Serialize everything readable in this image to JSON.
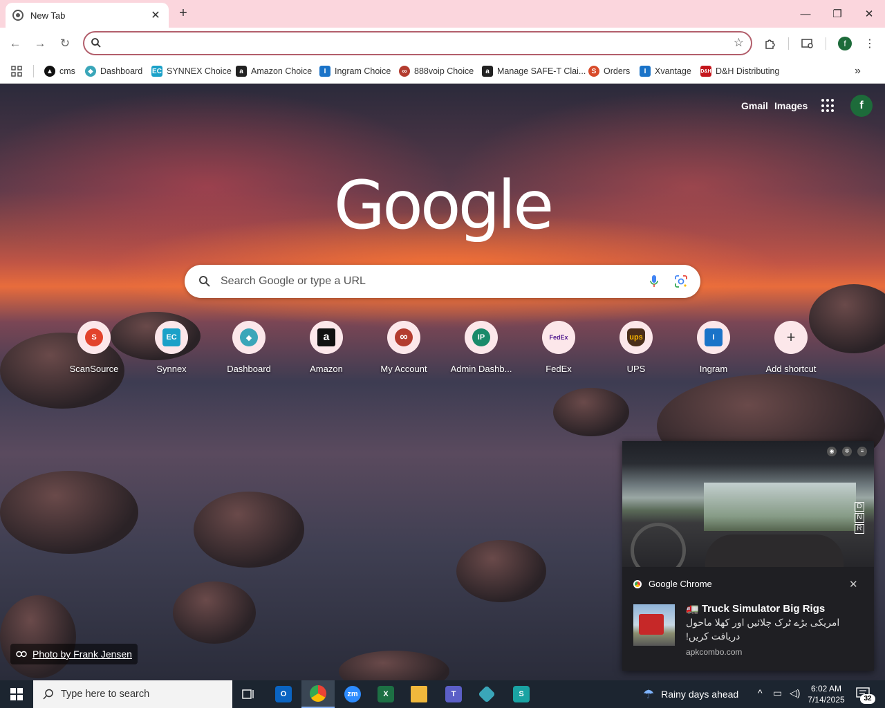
{
  "tab": {
    "title": "New Tab",
    "close": "✕",
    "new_tab": "+"
  },
  "window": {
    "minimize": "—",
    "maximize": "❐",
    "close": "✕"
  },
  "omnibox": {
    "value": ""
  },
  "bookmarks": [
    {
      "label": "cms",
      "icon": "cms-icon",
      "color": "#111111"
    },
    {
      "label": "Dashboard",
      "icon": "dashboard-icon",
      "color": "#3aa6b9"
    },
    {
      "label": "SYNNEX Choice",
      "icon": "synnex-icon",
      "color": "#1ba1c8"
    },
    {
      "label": "Amazon Choice",
      "icon": "amazon-icon",
      "color": "#222222"
    },
    {
      "label": "Ingram Choice",
      "icon": "ingram-icon",
      "color": "#1a73c8"
    },
    {
      "label": "888voip Choice",
      "icon": "888voip-icon",
      "color": "#b33c2f"
    },
    {
      "label": "Manage SAFE-T Clai...",
      "icon": "amazon-icon",
      "color": "#222222"
    },
    {
      "label": "Orders",
      "icon": "orders-icon",
      "color": "#d84b2a"
    },
    {
      "label": "Xvantage",
      "icon": "xvantage-icon",
      "color": "#1a73c8"
    },
    {
      "label": "D&H Distributing",
      "icon": "dh-icon",
      "color": "#c4161c"
    }
  ],
  "ntp": {
    "gmail": "Gmail",
    "images": "Images",
    "profile_initial": "f",
    "logo": "Google",
    "search_placeholder": "Search Google or type a URL",
    "shortcuts": [
      {
        "label": "ScanSource",
        "glyph": "S",
        "color": "#e2432c"
      },
      {
        "label": "Synnex",
        "glyph": "EC",
        "color": "#1ba1c8"
      },
      {
        "label": "Dashboard",
        "glyph": "◆",
        "color": "#3aa6b9"
      },
      {
        "label": "Amazon",
        "glyph": "a",
        "color": "#111111"
      },
      {
        "label": "My Account",
        "glyph": "∞",
        "color": "#b33c2f"
      },
      {
        "label": "Admin Dashb...",
        "glyph": "IP",
        "color": "#1a8a6a"
      },
      {
        "label": "FedEx",
        "glyph": "FedEx",
        "color": "#4d148c"
      },
      {
        "label": "UPS",
        "glyph": "ups",
        "color": "#4b2e1a"
      },
      {
        "label": "Ingram",
        "glyph": "I",
        "color": "#1a73c8"
      },
      {
        "label": "Add shortcut",
        "glyph": "+",
        "color": "#333333"
      }
    ],
    "photo_credit": "Photo by Frank Jensen"
  },
  "notification": {
    "app": "Google Chrome",
    "close": "✕",
    "title": "🚛 Truck Simulator Big Rigs",
    "body": "امریکی بڑے ٹرک چلائیں اور کھلا ماحول دریافت کریں!",
    "source": "apkcombo.com",
    "gears": [
      "D",
      "N",
      "R"
    ]
  },
  "taskbar": {
    "search_placeholder": "Type here to search",
    "weather": "Rainy days ahead",
    "time": "6:02 AM",
    "date": "7/14/2025",
    "notification_count": "32"
  }
}
